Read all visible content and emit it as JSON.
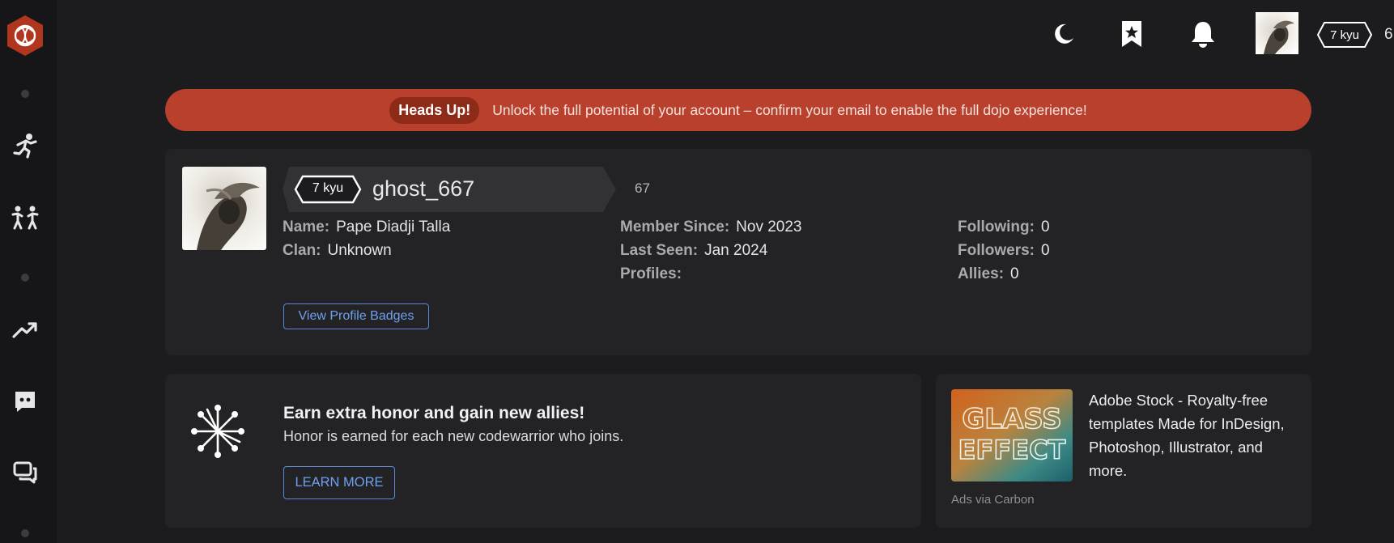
{
  "topbar": {
    "rank_label": "7 kyu",
    "honor_partial": "6"
  },
  "banner": {
    "tag": "Heads Up!",
    "message": "Unlock the full potential of your account – confirm your email to enable the full dojo experience!"
  },
  "profile": {
    "rank": "7 kyu",
    "username": "ghost_667",
    "honor": "67",
    "stats": {
      "name": {
        "label": "Name:",
        "value": "Pape Diadji Talla"
      },
      "clan": {
        "label": "Clan:",
        "value": "Unknown"
      },
      "member_since": {
        "label": "Member Since:",
        "value": "Nov 2023"
      },
      "last_seen": {
        "label": "Last Seen:",
        "value": "Jan 2024"
      },
      "profiles": {
        "label": "Profiles:",
        "value": ""
      },
      "following": {
        "label": "Following:",
        "value": "0"
      },
      "followers": {
        "label": "Followers:",
        "value": "0"
      },
      "allies": {
        "label": "Allies:",
        "value": "0"
      }
    },
    "badges_button": "View Profile Badges"
  },
  "referral": {
    "title": "Earn extra honor and gain new allies!",
    "subtitle": "Honor is earned for each new codewarrior who joins.",
    "button": "LEARN MORE"
  },
  "ad": {
    "image_text_1": "GLASS",
    "image_text_2": "EFFECT",
    "text": "Adobe Stock - Royalty-free templates Made for InDesign, Photoshop, Illustrator, and more.",
    "via": "Ads via Carbon"
  },
  "colors": {
    "brand": "#b8402c",
    "link": "#6fa0ef"
  },
  "icons": [
    "codewars-logo-icon",
    "practice-icon",
    "sparring-icon",
    "leaderboard-icon",
    "discord-icon",
    "discussion-icon",
    "moon-icon",
    "bookmark-icon",
    "bell-icon",
    "honor-network-icon"
  ]
}
